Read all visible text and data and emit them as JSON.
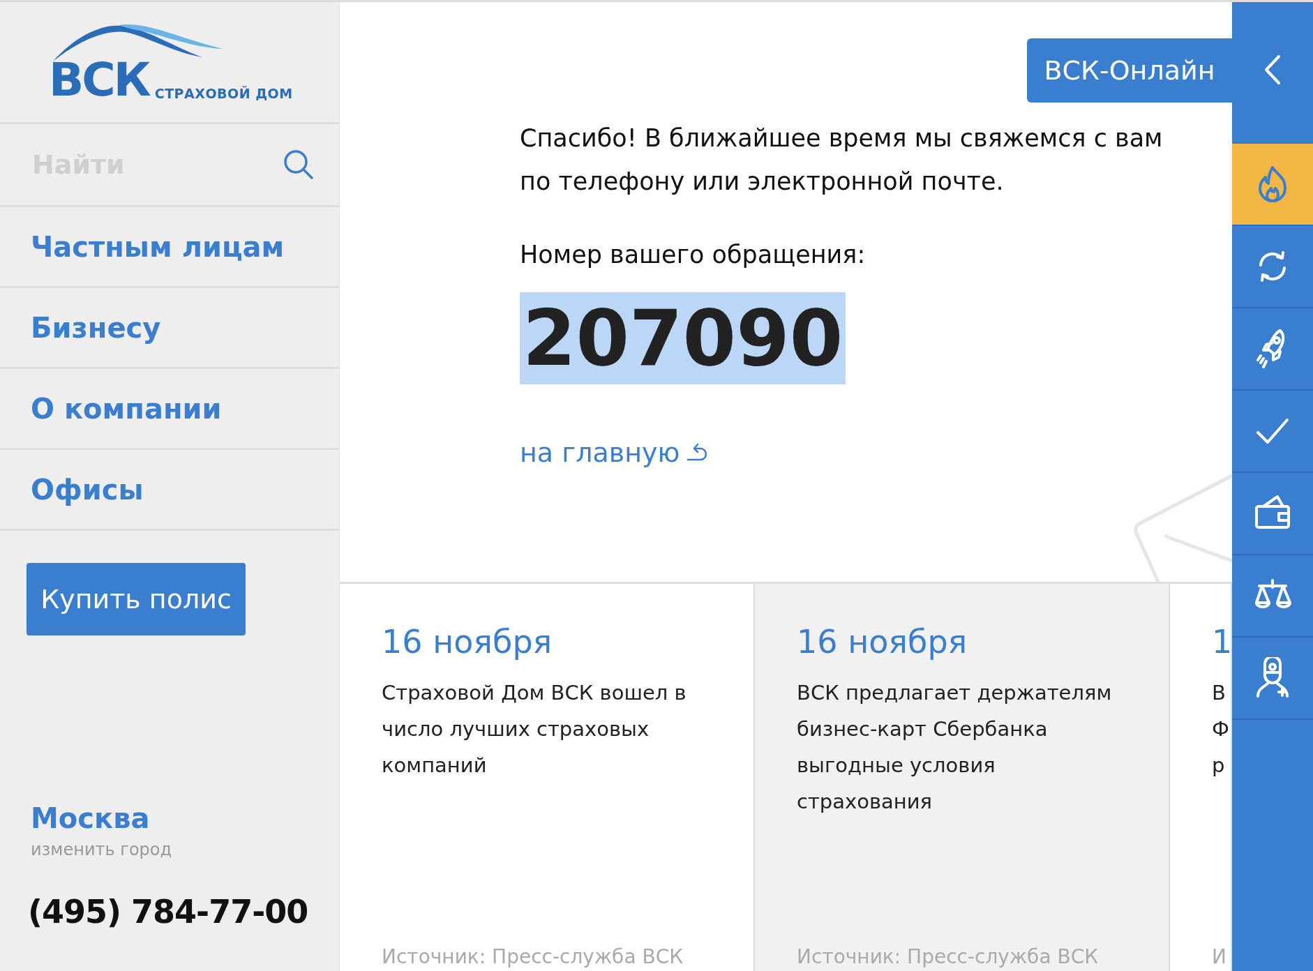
{
  "logo": {
    "mark": "ВСК",
    "tagline": "СТРАХОВОЙ ДОМ"
  },
  "search": {
    "placeholder": "Найти"
  },
  "nav": [
    {
      "label": "Частным лицам"
    },
    {
      "label": "Бизнесу"
    },
    {
      "label": "О компании"
    },
    {
      "label": "Офисы"
    }
  ],
  "buy_button": "Купить полис",
  "city": {
    "name": "Москва",
    "change": "изменить город"
  },
  "phone": "(495) 784-77-00",
  "online_button": "ВСК-Онлайн",
  "message": [
    "Спасибо! В ближайшее время мы свяжемся с вам",
    "по телефону или электронной почте."
  ],
  "request_label": "Номер вашего обращения:",
  "request_number": {
    "value": "207090",
    "selected": true
  },
  "home_link": "на главную",
  "news": [
    {
      "date": "16 ноября",
      "lines": [
        "Страховой Дом ВСК вошел в",
        "число лучших страховых",
        "компаний"
      ],
      "source": "Источник: Пресс-служба ВСК",
      "shaded": false
    },
    {
      "date": "16 ноября",
      "lines": [
        "ВСК предлагает держателям",
        "бизнес-карт Сбербанка",
        "выгодные условия",
        "страхования"
      ],
      "source": "Источник: Пресс-служба ВСК",
      "shaded": true
    },
    {
      "date": "1",
      "lines": [
        "В",
        "Ф",
        "р"
      ],
      "source": "И",
      "shaded": false
    }
  ],
  "tools": [
    {
      "kind": "fire",
      "selected": true
    },
    {
      "kind": "refresh",
      "selected": false
    },
    {
      "kind": "rocket",
      "selected": false
    },
    {
      "kind": "check",
      "selected": false
    },
    {
      "kind": "wallet",
      "selected": false
    },
    {
      "kind": "scales",
      "selected": false
    },
    {
      "kind": "doctor",
      "selected": false
    }
  ]
}
